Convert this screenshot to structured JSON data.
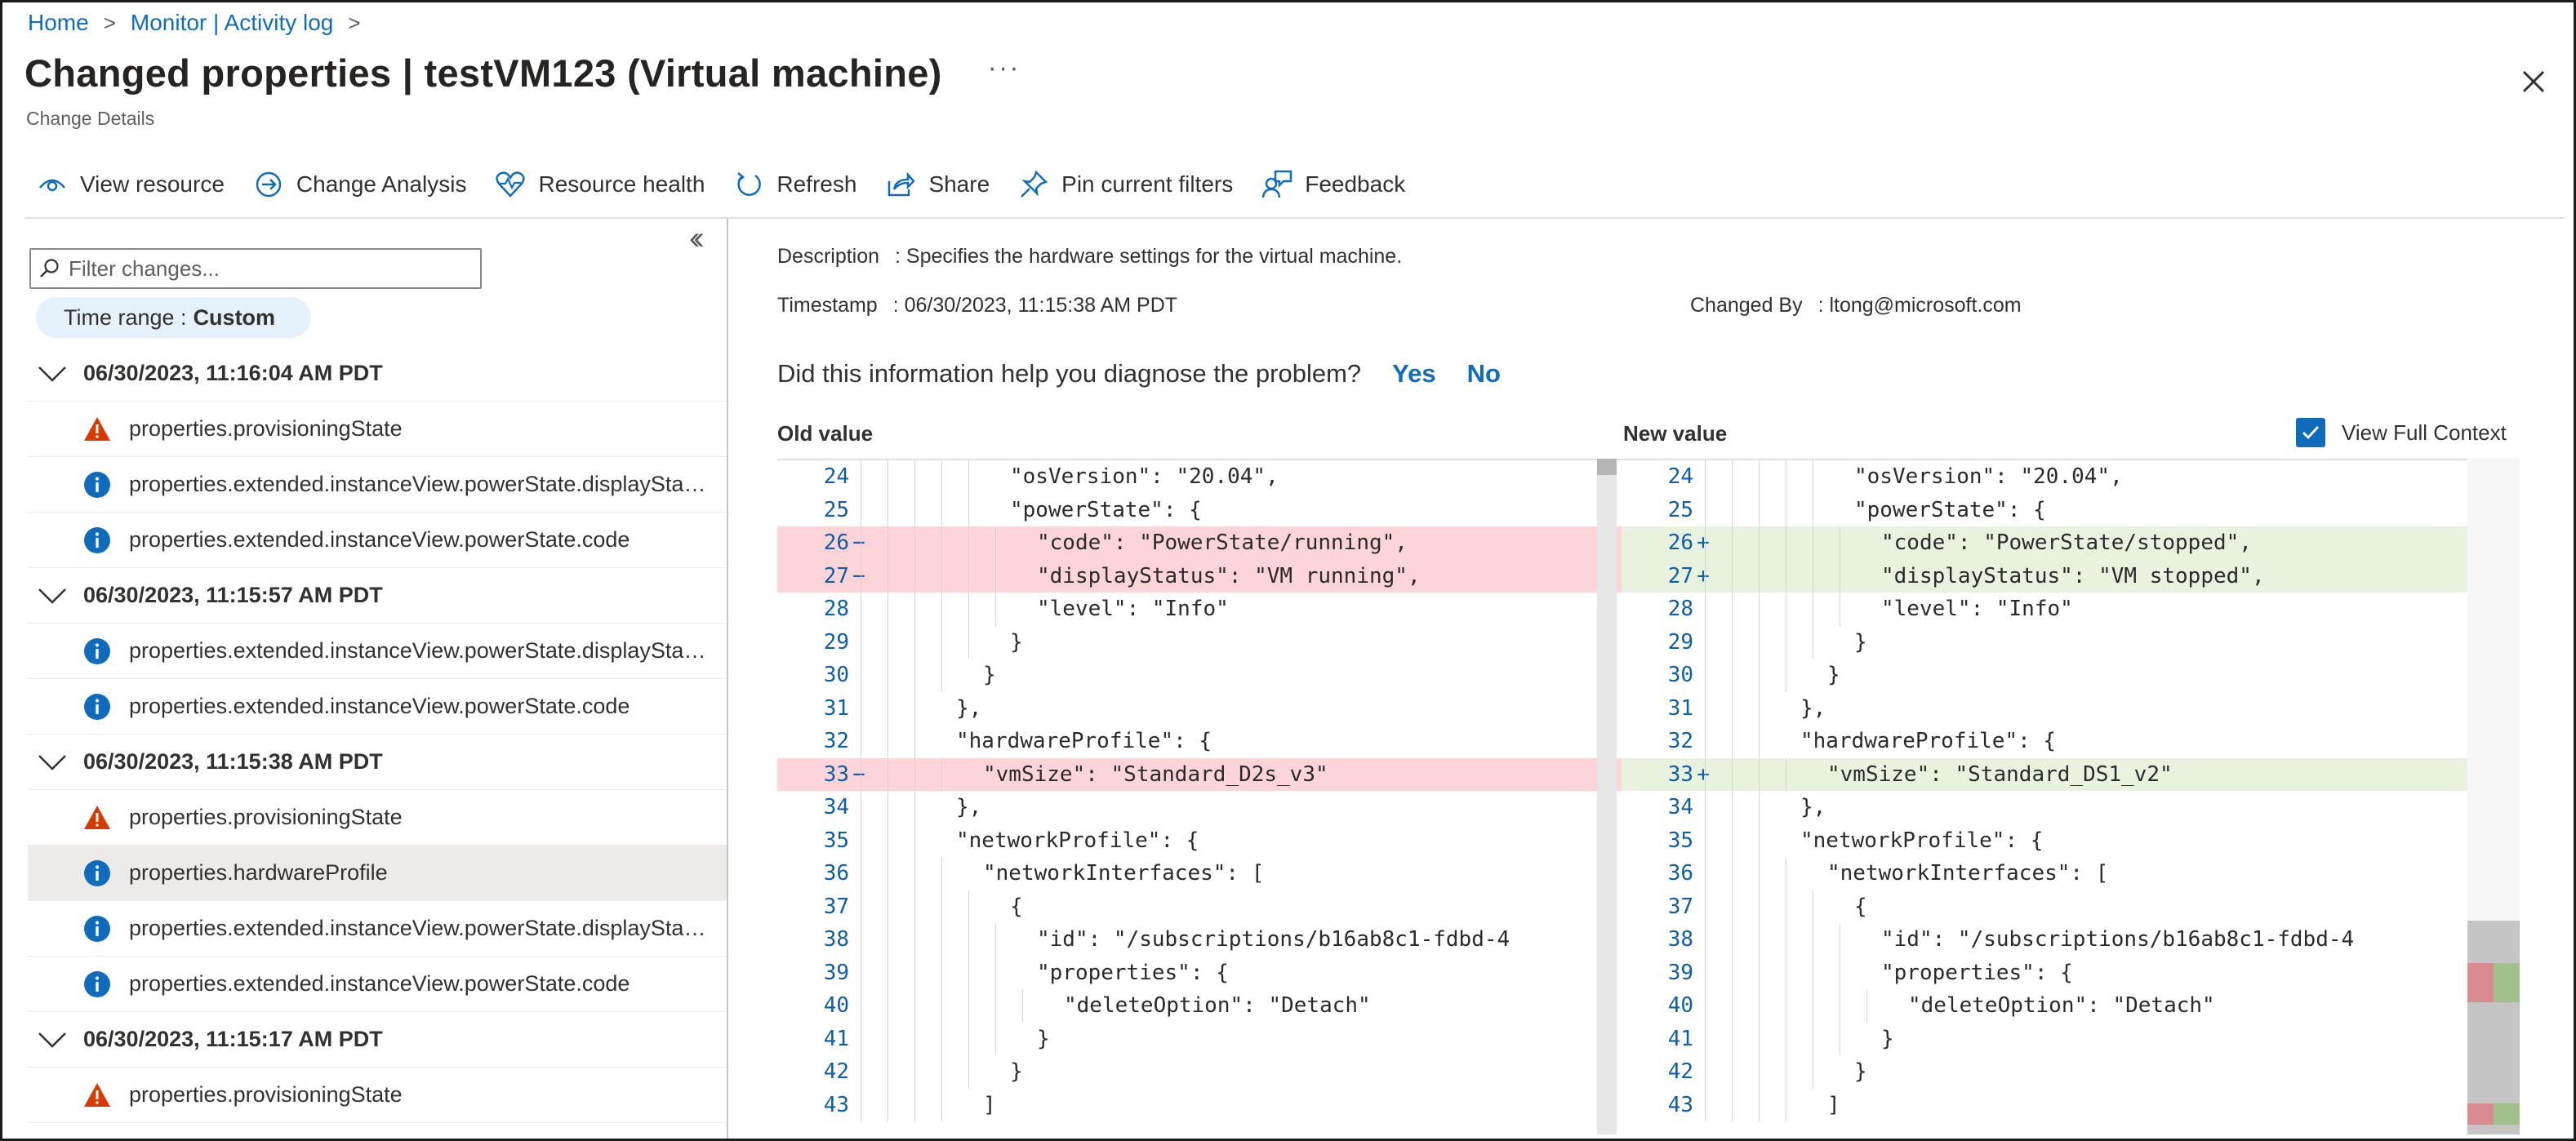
{
  "breadcrumb": [
    "Home",
    "Monitor | Activity log"
  ],
  "title": "Changed properties | testVM123 (Virtual machine)",
  "more_label": "···",
  "subtitle": "Change Details",
  "toolbar": [
    {
      "label": "View resource",
      "icon": "eye-icon"
    },
    {
      "label": "Change Analysis",
      "icon": "change-analysis-icon"
    },
    {
      "label": "Resource health",
      "icon": "heart-pulse-icon"
    },
    {
      "label": "Refresh",
      "icon": "refresh-icon"
    },
    {
      "label": "Share",
      "icon": "share-icon"
    },
    {
      "label": "Pin current filters",
      "icon": "pin-icon"
    },
    {
      "label": "Feedback",
      "icon": "feedback-icon"
    }
  ],
  "filter": {
    "placeholder": "Filter changes..."
  },
  "time_range": {
    "label": "Time range :",
    "value": "Custom"
  },
  "groups": [
    {
      "timestamp": "06/30/2023, 11:16:04 AM PDT",
      "items": [
        {
          "severity": "warning",
          "label": "properties.provisioningState"
        },
        {
          "severity": "info",
          "label": "properties.extended.instanceView.powerState.displayStatus"
        },
        {
          "severity": "info",
          "label": "properties.extended.instanceView.powerState.code"
        }
      ]
    },
    {
      "timestamp": "06/30/2023, 11:15:57 AM PDT",
      "items": [
        {
          "severity": "info",
          "label": "properties.extended.instanceView.powerState.displayStatus"
        },
        {
          "severity": "info",
          "label": "properties.extended.instanceView.powerState.code"
        }
      ]
    },
    {
      "timestamp": "06/30/2023, 11:15:38 AM PDT",
      "items": [
        {
          "severity": "warning",
          "label": "properties.provisioningState"
        },
        {
          "severity": "info",
          "label": "properties.hardwareProfile",
          "selected": true
        },
        {
          "severity": "info",
          "label": "properties.extended.instanceView.powerState.displayStatus"
        },
        {
          "severity": "info",
          "label": "properties.extended.instanceView.powerState.code"
        }
      ]
    },
    {
      "timestamp": "06/30/2023, 11:15:17 AM PDT",
      "items": [
        {
          "severity": "warning",
          "label": "properties.provisioningState"
        }
      ]
    }
  ],
  "details": {
    "description_label": "Description",
    "description": ": Specifies the hardware settings for the virtual machine.",
    "timestamp_label": "Timestamp",
    "timestamp": ": 06/30/2023, 11:15:38 AM PDT",
    "changed_by_label": "Changed By",
    "changed_by": ": ltong@microsoft.com"
  },
  "feedback": {
    "question": "Did this information help you diagnose the problem?",
    "yes": "Yes",
    "no": "No"
  },
  "diff": {
    "old_label": "Old value",
    "new_label": "New value",
    "full_context_label": "View Full Context",
    "full_context_checked": true,
    "old_lines": [
      {
        "n": "24",
        "t": "",
        "indent": 5,
        "c": "\"osVersion\": \"20.04\","
      },
      {
        "n": "25",
        "t": "",
        "indent": 5,
        "c": "\"powerState\": {"
      },
      {
        "n": "26",
        "t": "del",
        "indent": 6,
        "c": "\"code\": \"PowerState/running\","
      },
      {
        "n": "27",
        "t": "del",
        "indent": 6,
        "c": "\"displayStatus\": \"VM running\","
      },
      {
        "n": "28",
        "t": "",
        "indent": 6,
        "c": "\"level\": \"Info\""
      },
      {
        "n": "29",
        "t": "",
        "indent": 5,
        "c": "}"
      },
      {
        "n": "30",
        "t": "",
        "indent": 4,
        "c": "}"
      },
      {
        "n": "31",
        "t": "",
        "indent": 3,
        "c": "},"
      },
      {
        "n": "32",
        "t": "",
        "indent": 3,
        "c": "\"hardwareProfile\": {"
      },
      {
        "n": "33",
        "t": "del",
        "indent": 4,
        "c": "\"vmSize\": \"Standard_D2s_v3\""
      },
      {
        "n": "34",
        "t": "",
        "indent": 3,
        "c": "},"
      },
      {
        "n": "35",
        "t": "",
        "indent": 3,
        "c": "\"networkProfile\": {"
      },
      {
        "n": "36",
        "t": "",
        "indent": 4,
        "c": "\"networkInterfaces\": ["
      },
      {
        "n": "37",
        "t": "",
        "indent": 5,
        "c": "{"
      },
      {
        "n": "38",
        "t": "",
        "indent": 6,
        "c": "\"id\": \"/subscriptions/b16ab8c1-fdbd-4"
      },
      {
        "n": "39",
        "t": "",
        "indent": 6,
        "c": "\"properties\": {"
      },
      {
        "n": "40",
        "t": "",
        "indent": 7,
        "c": "\"deleteOption\": \"Detach\""
      },
      {
        "n": "41",
        "t": "",
        "indent": 6,
        "c": "}"
      },
      {
        "n": "42",
        "t": "",
        "indent": 5,
        "c": "}"
      },
      {
        "n": "43",
        "t": "",
        "indent": 4,
        "c": "]"
      }
    ],
    "new_lines": [
      {
        "n": "24",
        "t": "",
        "indent": 5,
        "c": "\"osVersion\": \"20.04\","
      },
      {
        "n": "25",
        "t": "",
        "indent": 5,
        "c": "\"powerState\": {"
      },
      {
        "n": "26",
        "t": "add",
        "indent": 6,
        "c": "\"code\": \"PowerState/stopped\","
      },
      {
        "n": "27",
        "t": "add",
        "indent": 6,
        "c": "\"displayStatus\": \"VM stopped\","
      },
      {
        "n": "28",
        "t": "",
        "indent": 6,
        "c": "\"level\": \"Info\""
      },
      {
        "n": "29",
        "t": "",
        "indent": 5,
        "c": "}"
      },
      {
        "n": "30",
        "t": "",
        "indent": 4,
        "c": "}"
      },
      {
        "n": "31",
        "t": "",
        "indent": 3,
        "c": "},"
      },
      {
        "n": "32",
        "t": "",
        "indent": 3,
        "c": "\"hardwareProfile\": {"
      },
      {
        "n": "33",
        "t": "add",
        "indent": 4,
        "c": "\"vmSize\": \"Standard_DS1_v2\""
      },
      {
        "n": "34",
        "t": "",
        "indent": 3,
        "c": "},"
      },
      {
        "n": "35",
        "t": "",
        "indent": 3,
        "c": "\"networkProfile\": {"
      },
      {
        "n": "36",
        "t": "",
        "indent": 4,
        "c": "\"networkInterfaces\": ["
      },
      {
        "n": "37",
        "t": "",
        "indent": 5,
        "c": "{"
      },
      {
        "n": "38",
        "t": "",
        "indent": 6,
        "c": "\"id\": \"/subscriptions/b16ab8c1-fdbd-4"
      },
      {
        "n": "39",
        "t": "",
        "indent": 6,
        "c": "\"properties\": {"
      },
      {
        "n": "40",
        "t": "",
        "indent": 7,
        "c": "\"deleteOption\": \"Detach\""
      },
      {
        "n": "41",
        "t": "",
        "indent": 6,
        "c": "}"
      },
      {
        "n": "42",
        "t": "",
        "indent": 5,
        "c": "}"
      },
      {
        "n": "43",
        "t": "",
        "indent": 4,
        "c": "]"
      }
    ]
  },
  "colors": {
    "accent": "#0f6cbd",
    "deleted_line": "#fdd4d7",
    "added_line": "#e9f2df",
    "warning": "#d83b01",
    "info": "#0f6cbd"
  }
}
